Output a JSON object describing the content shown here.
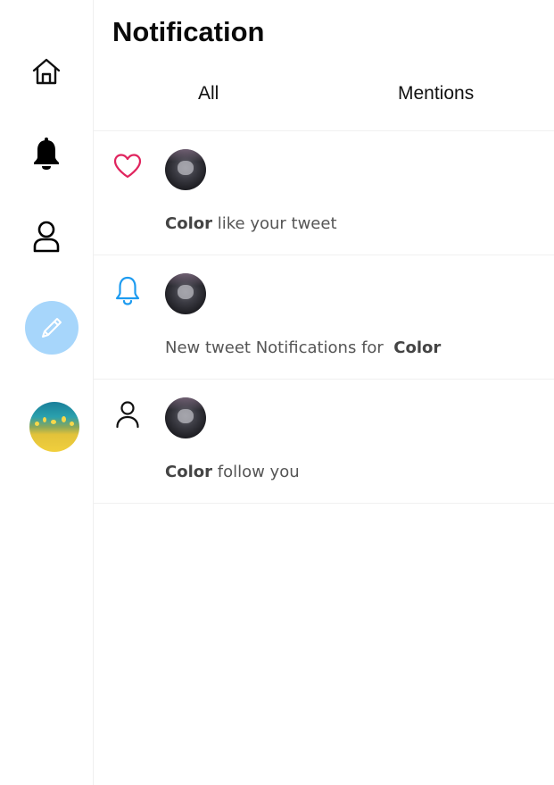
{
  "header": {
    "title": "Notification"
  },
  "tabs": [
    {
      "label": "All"
    },
    {
      "label": "Mentions"
    }
  ],
  "sidebar": {
    "items": [
      {
        "icon": "home-icon"
      },
      {
        "icon": "bell-icon"
      },
      {
        "icon": "user-icon"
      },
      {
        "icon": "pencil-icon"
      }
    ],
    "compose_color": "#a7d6fb"
  },
  "notifications": [
    {
      "type_icon": "heart-icon",
      "type_color": "#e0245e",
      "user": "Color",
      "text": "like your tweet"
    },
    {
      "type_icon": "bell-icon",
      "type_color": "#1d9bf0",
      "prefix": "New tweet Notifications for",
      "user": "Color"
    },
    {
      "type_icon": "user-icon",
      "type_color": "#111111",
      "user": "Color",
      "text": "follow you"
    }
  ]
}
